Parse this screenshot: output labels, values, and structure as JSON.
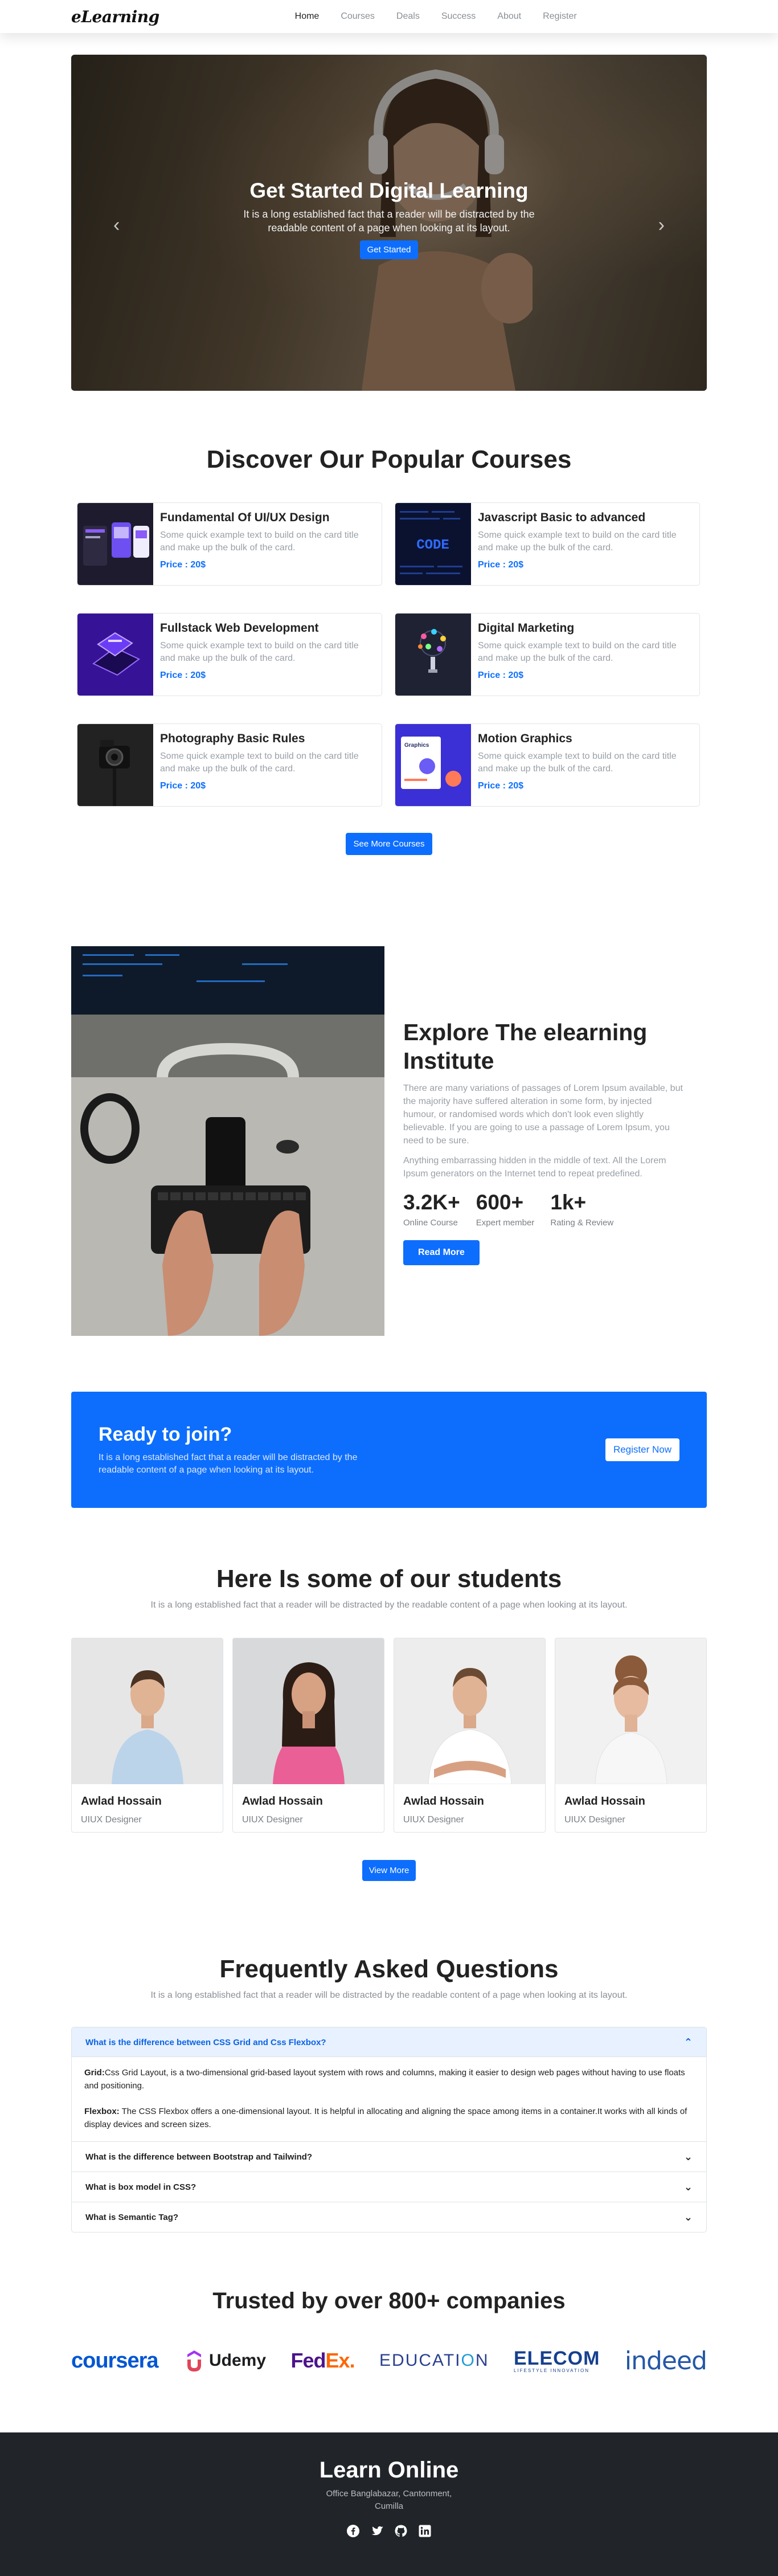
{
  "brand": "eLearning",
  "nav": {
    "links": [
      {
        "label": "Home"
      },
      {
        "label": "Courses"
      },
      {
        "label": "Deals"
      },
      {
        "label": "Success"
      },
      {
        "label": "About"
      },
      {
        "label": "Register"
      }
    ]
  },
  "hero": {
    "title": "Get Started Digital Learning",
    "text": "It is a long established fact that a reader will be distracted by the readable content of a page when looking at its layout.",
    "button": "Get Started",
    "prev_arrow": "‹",
    "next_arrow": "›"
  },
  "courses": {
    "title": "Discover Our Popular Courses",
    "items": [
      {
        "title": "Fundamental Of UI/UX Design",
        "desc": "Some quick example text to build on the card title and make up the bulk of the card.",
        "price": "Price : 20$",
        "thumb": "uiux"
      },
      {
        "title": "Javascript Basic to advanced",
        "desc": "Some quick example text to build on the card title and make up the bulk of the card.",
        "price": "Price : 20$",
        "thumb": "code"
      },
      {
        "title": "Fullstack Web Development",
        "desc": "Some quick example text to build on the card title and make up the bulk of the card.",
        "price": "Price : 20$",
        "thumb": "laptop"
      },
      {
        "title": "Digital Marketing",
        "desc": "Some quick example text to build on the card title and make up the bulk of the card.",
        "price": "Price : 20$",
        "thumb": "marketing"
      },
      {
        "title": "Photography Basic Rules",
        "desc": "Some quick example text to build on the card title and make up the bulk of the card.",
        "price": "Price : 20$",
        "thumb": "camera"
      },
      {
        "title": "Motion Graphics",
        "desc": "Some quick example text to build on the card title and make up the bulk of the card.",
        "price": "Price : 20$",
        "thumb": "graphics"
      }
    ],
    "code_thumb_text": "CODE",
    "graphics_thumb_text": "Graphics",
    "button": "See More Courses"
  },
  "explore": {
    "title": "Explore The elearning Institute",
    "para1": "There are many variations of passages of Lorem Ipsum available, but the majority have suffered alteration in some form, by injected humour, or randomised words which don't look even slightly believable. If you are going to use a passage of Lorem Ipsum, you need to be sure.",
    "para2": "Anything embarrassing hidden in the middle of text. All the Lorem Ipsum generators on the Internet tend to repeat predefined.",
    "stats": [
      {
        "value": "3.2K+",
        "label": "Online Course"
      },
      {
        "value": "600+",
        "label": "Expert member"
      },
      {
        "value": "1k+",
        "label": "Rating & Review"
      }
    ],
    "button": "Read More"
  },
  "cta": {
    "title": "Ready to join?",
    "text": "It is a long established fact that a reader will be distracted by the readable content of a page when looking at its layout.",
    "button": "Register Now"
  },
  "students": {
    "title": "Here Is some of our students",
    "subtitle": "It is a long established fact that a reader will be distracted by the readable content of a page when looking at its layout.",
    "items": [
      {
        "name": "Awlad Hossain",
        "role": "UIUX Designer"
      },
      {
        "name": "Awlad Hossain",
        "role": "UIUX Designer"
      },
      {
        "name": "Awlad Hossain",
        "role": "UIUX Designer"
      },
      {
        "name": "Awlad Hossain",
        "role": "UIUX Designer"
      }
    ],
    "button": "View More"
  },
  "faq": {
    "title": "Frequently Asked Questions",
    "subtitle": "It is a long established fact that a reader will be distracted by the readable content of a page when looking at its layout.",
    "items": [
      {
        "question": "What is the difference between CSS Grid and Css Flexbox?",
        "open": true,
        "answer1_label": "Grid:",
        "answer1_text": "Css Grid Layout, is a two-dimensional grid-based layout system with rows and columns, making it easier to design web pages without having to use floats and positioning.",
        "answer2_label": "Flexbox:",
        "answer2_text": " The CSS Flexbox offers a one-dimensional layout. It is helpful in allocating and aligning the space among items in a container.It works with all kinds of display devices and screen sizes."
      },
      {
        "question": "What is the difference between Bootstrap and Tailwind?",
        "open": false
      },
      {
        "question": "What is box model in CSS?",
        "open": false
      },
      {
        "question": "What is Semantic Tag?",
        "open": false
      }
    ],
    "chevron_up": "⌃",
    "chevron_down": "⌄"
  },
  "trusted": {
    "title": "Trusted by over 800+ companies",
    "logos": {
      "coursera": "coursera",
      "udemy": "Udemy",
      "fedex_fed": "Fed",
      "fedex_ex": "Ex",
      "fedex_dot": ".",
      "education": "EDUCATI",
      "education_o": "O",
      "education_n": "N",
      "elecom": "ELECOM",
      "elecom_tag": "LIFESTYLE INNOVATION",
      "indeed": "indeed"
    }
  },
  "footer": {
    "title": "Learn Online",
    "address_line1": "Office Banglabazar, Cantonment,",
    "address_line2": "Cumilla",
    "social": [
      "facebook-icon",
      "twitter-icon",
      "github-icon",
      "linkedin-icon"
    ]
  },
  "colors": {
    "primary": "#0d6efd",
    "footer_bg": "#212529",
    "muted_text": "#9aa0a6",
    "faq_open_bg": "#e7f1ff",
    "fedex_purple": "#4d148c",
    "fedex_orange": "#ff6600",
    "udemy_red": "#a435f0"
  }
}
